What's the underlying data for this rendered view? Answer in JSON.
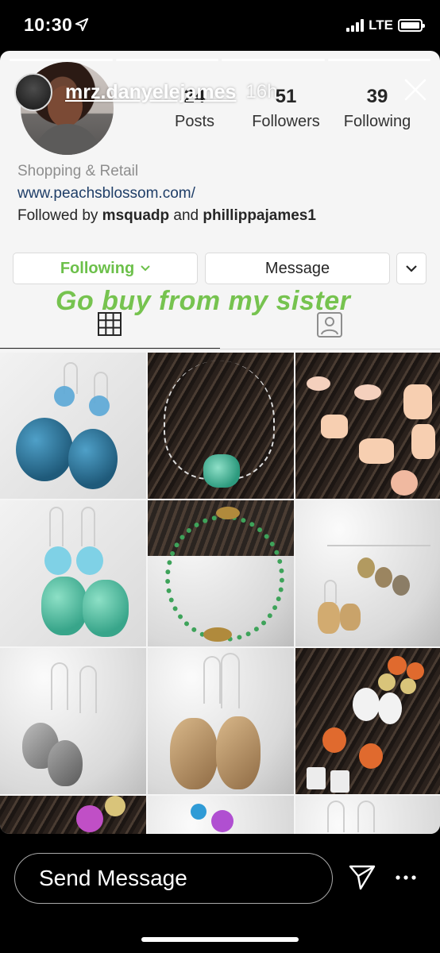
{
  "status_bar": {
    "time": "10:30",
    "network": "LTE",
    "battery_level": 1.0,
    "icons": [
      "location-arrow-icon",
      "signal-icon",
      "battery-icon"
    ]
  },
  "story": {
    "username": "mrz.danyelejames",
    "time_ago": "16h",
    "segment_count": 4,
    "sticker_text": "Go buy from my sister",
    "sticker_color": "#76c34f"
  },
  "profile": {
    "stats": [
      {
        "value": "24",
        "label": "Posts"
      },
      {
        "value": "51",
        "label": "Followers"
      },
      {
        "value": "39",
        "label": "Following"
      }
    ],
    "category": "Shopping & Retail",
    "website": "www.peachsblossom.com/",
    "followed_by": {
      "prefix": "Followed by",
      "user1": "msquadp",
      "joiner": "and",
      "user2": "phillippajames1"
    },
    "buttons": {
      "following": "Following",
      "message": "Message"
    },
    "accent_color": "#6cc04a"
  },
  "tabs": {
    "icons": [
      "grid-icon",
      "tagged-icon"
    ],
    "active": "grid"
  },
  "bottom_bar": {
    "placeholder": "Send Message"
  }
}
